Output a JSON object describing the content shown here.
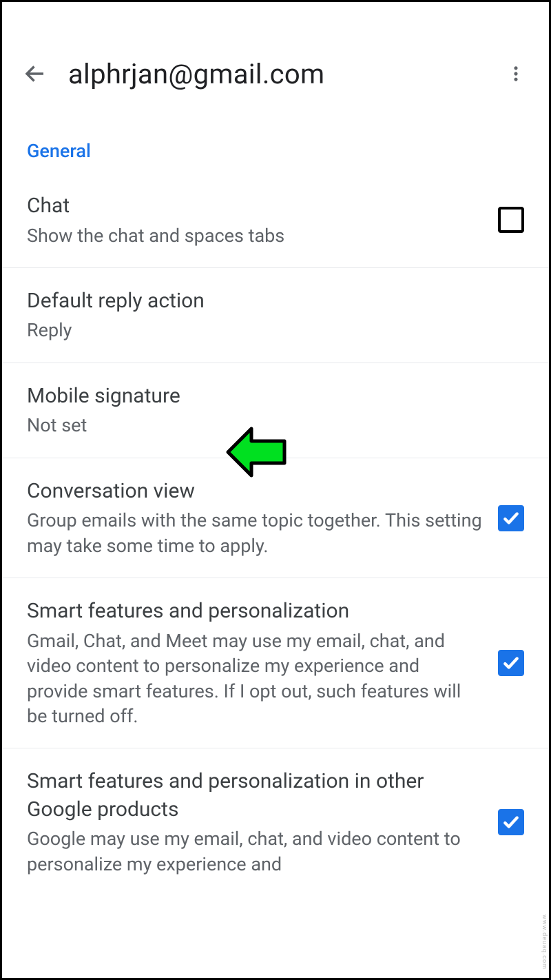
{
  "header": {
    "title": "alphrjan@gmail.com"
  },
  "section_label": "General",
  "settings": {
    "chat": {
      "title": "Chat",
      "sub": "Show the chat and spaces tabs",
      "checked": false
    },
    "default_reply": {
      "title": "Default reply action",
      "sub": "Reply"
    },
    "mobile_signature": {
      "title": "Mobile signature",
      "sub": "Not set"
    },
    "conversation_view": {
      "title": "Conversation view",
      "sub": "Group emails with the same topic together. This setting may take some time to apply.",
      "checked": true
    },
    "smart_features": {
      "title": "Smart features and personalization",
      "sub": "Gmail, Chat, and Meet may use my email, chat, and video content to personalize my experience and provide smart features. If I opt out, such features will be turned off.",
      "checked": true
    },
    "smart_features_other": {
      "title": "Smart features and personalization in other Google products",
      "sub": "Google may use my email, chat, and video content to personalize my experience and",
      "checked": true
    }
  },
  "watermark": "www.deuaq.com"
}
